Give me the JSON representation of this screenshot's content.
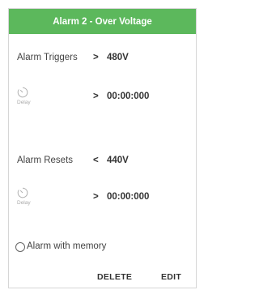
{
  "header": {
    "title": "Alarm 2 - Over Voltage"
  },
  "trigger": {
    "label": "Alarm Triggers",
    "operator": ">",
    "value": "480V",
    "delay": {
      "icon": "timer-icon",
      "label": "Delay",
      "operator": ">",
      "value": "00:00:000"
    }
  },
  "reset": {
    "label": "Alarm Resets",
    "operator": "<",
    "value": "440V",
    "delay": {
      "icon": "timer-icon",
      "label": "Delay",
      "operator": ">",
      "value": "00:00:000"
    }
  },
  "memory": {
    "label": "Alarm with memory",
    "checked": false
  },
  "actions": {
    "delete_label": "DELETE",
    "edit_label": "EDIT"
  },
  "colors": {
    "header_bg": "#5cb85c",
    "header_text": "#ffffff"
  }
}
